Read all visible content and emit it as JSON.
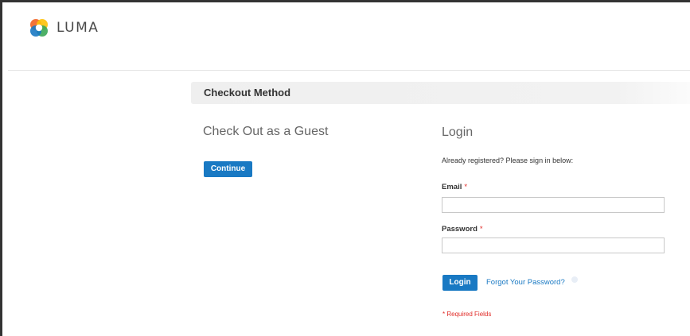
{
  "brand": {
    "name": "LUMA",
    "logo_colors": [
      "#f26322",
      "#ffc107",
      "#3aa757",
      "#1979c3"
    ]
  },
  "checkout": {
    "section_title": "Checkout Method",
    "guest": {
      "title": "Check Out as a Guest",
      "continue_label": "Continue"
    },
    "login": {
      "title": "Login",
      "note": "Already registered? Please sign in below:",
      "email_label": "Email",
      "email_value": "",
      "password_label": "Password",
      "password_value": "",
      "required_marker": "*",
      "login_label": "Login",
      "forgot_label": "Forgot Your Password?",
      "required_fields_note": "* Required Fields"
    }
  },
  "colors": {
    "primary_button": "#1979c3",
    "link": "#1979c3",
    "required": "#e02b27"
  }
}
